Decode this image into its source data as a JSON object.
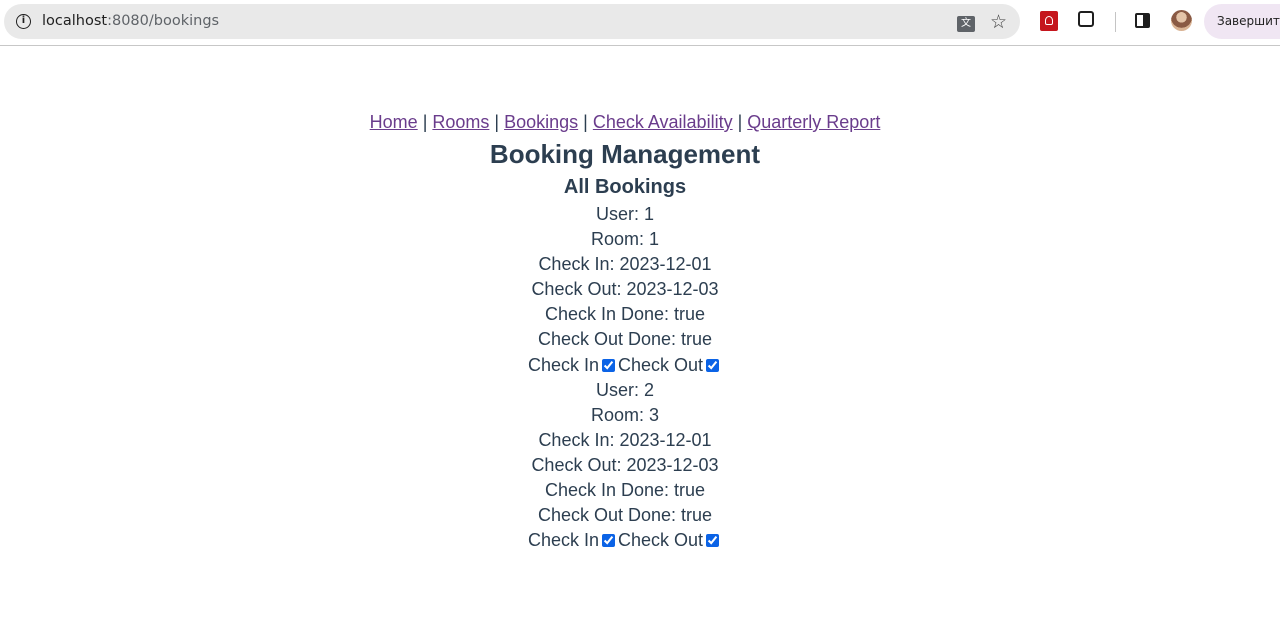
{
  "browser": {
    "url_host": "localhost",
    "url_rest": ":8080/bookings",
    "finish_button": "Завершить"
  },
  "nav": {
    "links": [
      "Home",
      "Rooms",
      "Bookings",
      "Check Availability",
      "Quarterly Report"
    ],
    "separator": " | "
  },
  "page": {
    "title": "Booking Management",
    "subtitle": "All Bookings"
  },
  "bookings": [
    {
      "user": "User: 1",
      "room": "Room: 1",
      "check_in": "Check In: 2023-12-01",
      "check_out": "Check Out: 2023-12-03",
      "check_in_done": "Check In Done: true",
      "check_out_done": "Check Out Done: true",
      "check_in_label": "Check In",
      "check_out_label": "Check Out",
      "check_in_checked": true,
      "check_out_checked": true
    },
    {
      "user": "User: 2",
      "room": "Room: 3",
      "check_in": "Check In: 2023-12-01",
      "check_out": "Check Out: 2023-12-03",
      "check_in_done": "Check In Done: true",
      "check_out_done": "Check Out Done: true",
      "check_in_label": "Check In",
      "check_out_label": "Check Out",
      "check_in_checked": true,
      "check_out_checked": true
    }
  ]
}
